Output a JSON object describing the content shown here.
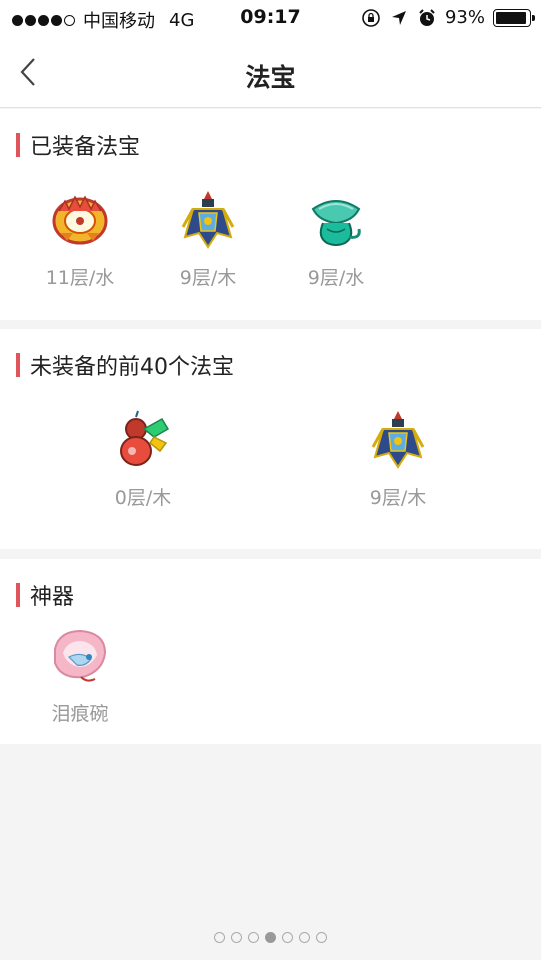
{
  "status": {
    "carrier": "中国移动",
    "network": "4G",
    "time": "09:17",
    "battery_text": "93%",
    "battery_level": 0.93,
    "signal_bars": 4
  },
  "nav": {
    "title": "法宝"
  },
  "equipped": {
    "title": "已装备法宝",
    "items": [
      {
        "label": "11层/水",
        "icon": "golden-ring-treasure-icon"
      },
      {
        "label": "9层/木",
        "icon": "robe-treasure-icon"
      },
      {
        "label": "9层/水",
        "icon": "jade-shell-treasure-icon"
      }
    ]
  },
  "unequipped": {
    "title": "未装备的前40个法宝",
    "items": [
      {
        "label": "0层/木",
        "icon": "gourd-treasure-icon"
      },
      {
        "label": "9层/木",
        "icon": "robe-treasure-icon"
      }
    ]
  },
  "artifacts": {
    "title": "神器",
    "items": [
      {
        "label": "泪痕碗",
        "icon": "tear-bowl-icon"
      }
    ]
  },
  "pagination": {
    "count": 7,
    "active_index": 3
  },
  "colors": {
    "accent_bar": "#e0555a",
    "label_gray": "#999999"
  }
}
